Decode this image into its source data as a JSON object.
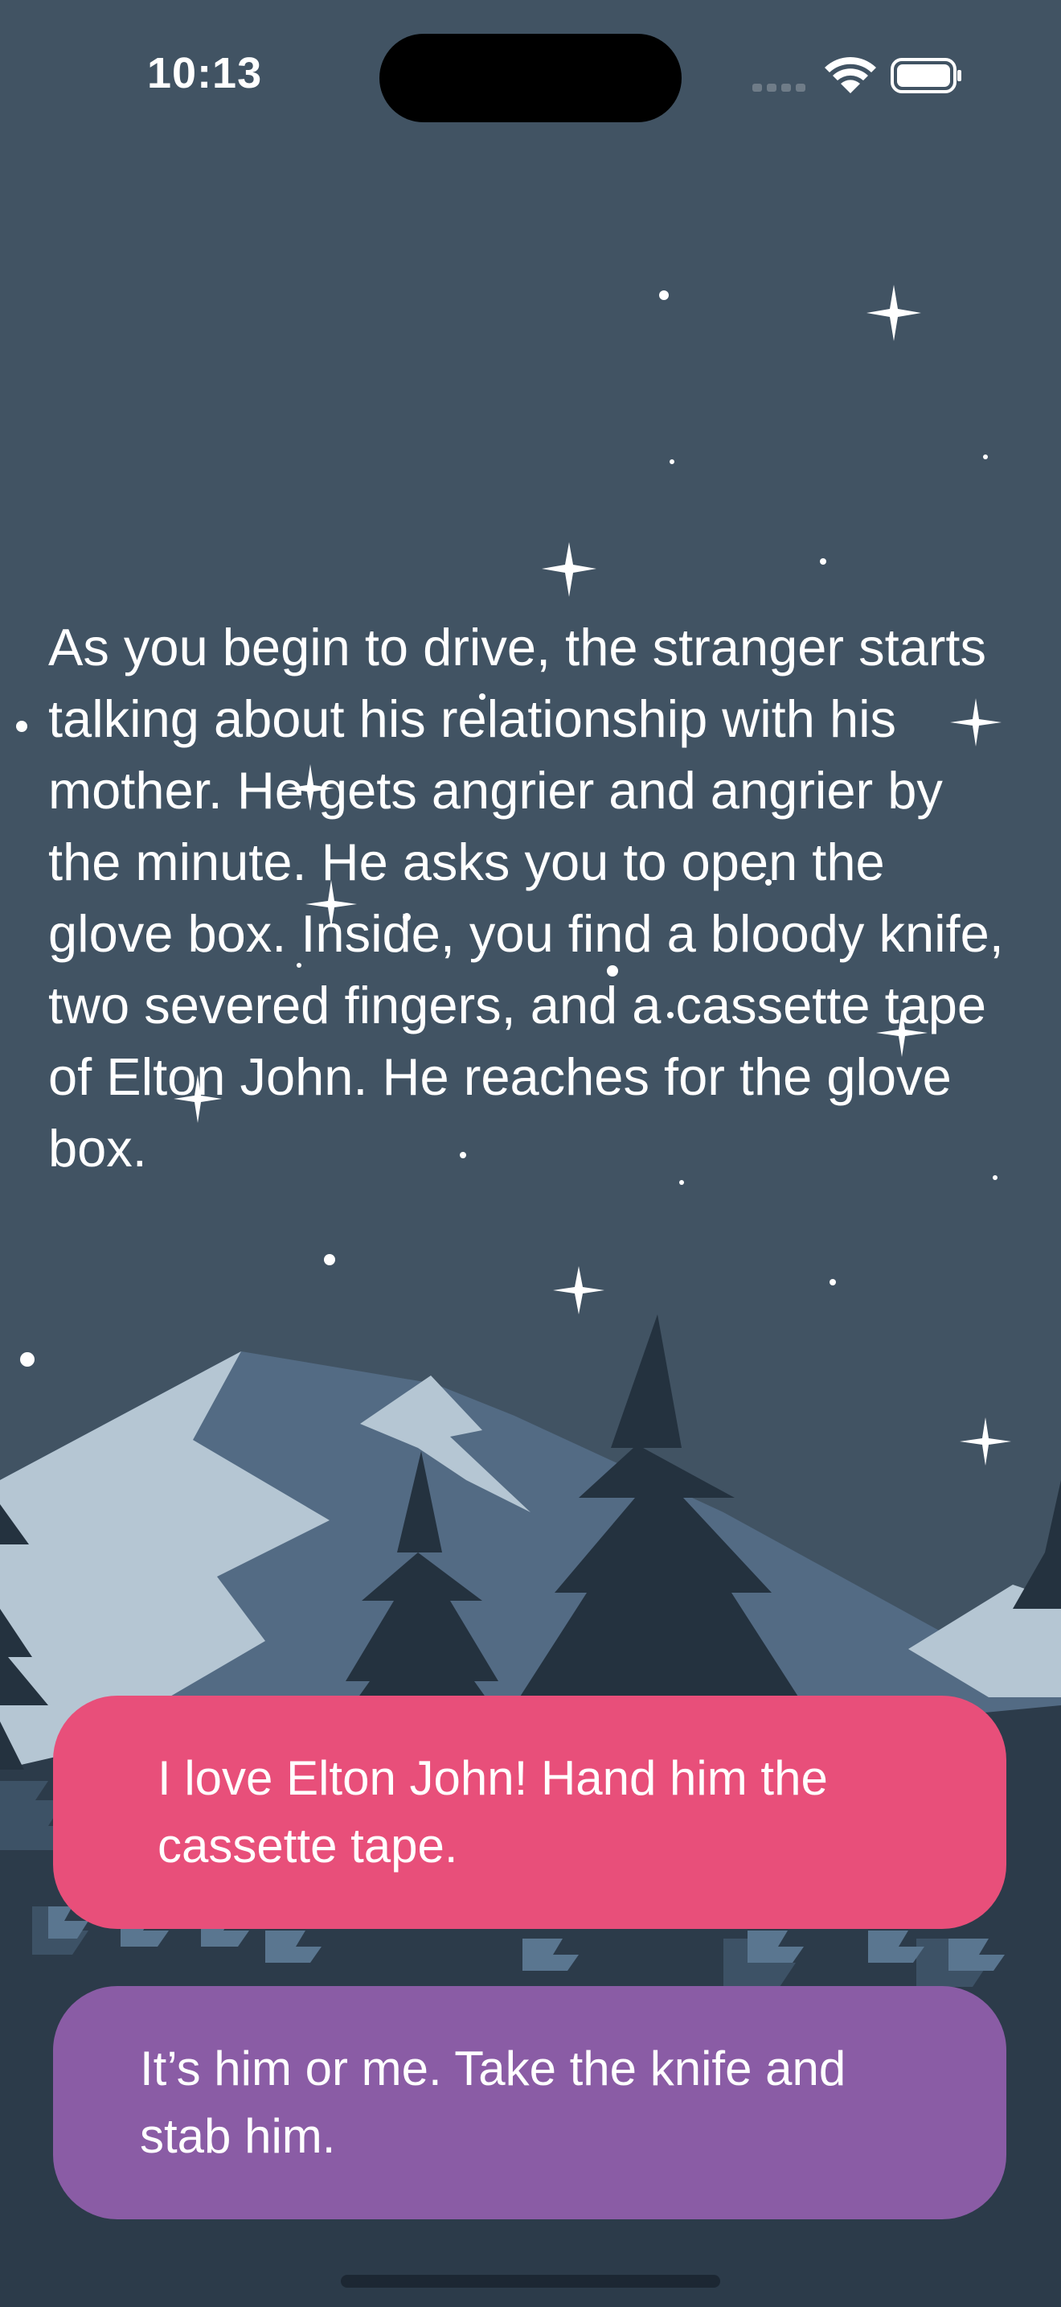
{
  "status_bar": {
    "time": "10:13",
    "icons": [
      "cellular-signal-icon",
      "wifi-icon",
      "battery-icon"
    ]
  },
  "story": {
    "text": "As you begin to drive, the stranger starts talking about his relationship with his mother. He gets angrier and angrier by the minute. He asks you to open the glove box. Inside, you find a bloody knife, two severed fingers, and a cassette tape of Elton John. He reaches for the glove box."
  },
  "choices": [
    {
      "label": "I love Elton John! Hand him the cassette tape.",
      "color": "#e84f7a"
    },
    {
      "label": "It’s him or me. Take the knife and stab him.",
      "color": "#8a5ca5"
    }
  ],
  "colors": {
    "sky": "#415363",
    "mountain_light": "#b5c6d3",
    "mountain_mid": "#536b84",
    "tree_dark": "#24323f",
    "tree_mid": "#3d5266",
    "tree_light": "#5a7690"
  }
}
